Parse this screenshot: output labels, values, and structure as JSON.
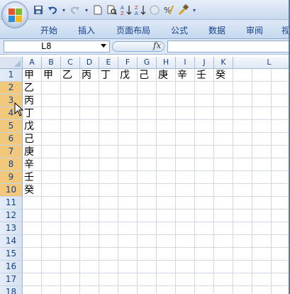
{
  "ribbon": {
    "tabs": [
      "开始",
      "插入",
      "页面布局",
      "公式",
      "数据",
      "审阅",
      "视"
    ]
  },
  "formula_bar": {
    "name_box": "L8",
    "fx_label": "fx",
    "formula": ""
  },
  "sheet": {
    "columns": [
      "A",
      "B",
      "C",
      "D",
      "E",
      "F",
      "G",
      "H",
      "I",
      "J",
      "K",
      "L"
    ],
    "rows": [
      "1",
      "2",
      "3",
      "4",
      "5",
      "6",
      "7",
      "8",
      "9",
      "10",
      "11",
      "12",
      "13",
      "14",
      "15",
      "16",
      "17",
      "18"
    ],
    "row1": [
      "甲",
      "甲",
      "乙",
      "丙",
      "丁",
      "戊",
      "己",
      "庚",
      "辛",
      "壬",
      "癸"
    ],
    "colA_rows2_10": [
      "乙",
      "丙",
      "丁",
      "戊",
      "己",
      "庚",
      "辛",
      "壬",
      "癸"
    ]
  },
  "colors": {
    "header_text": "#15428b",
    "gridline": "#d0d7e5",
    "active_row_header": "#f2c87c"
  }
}
